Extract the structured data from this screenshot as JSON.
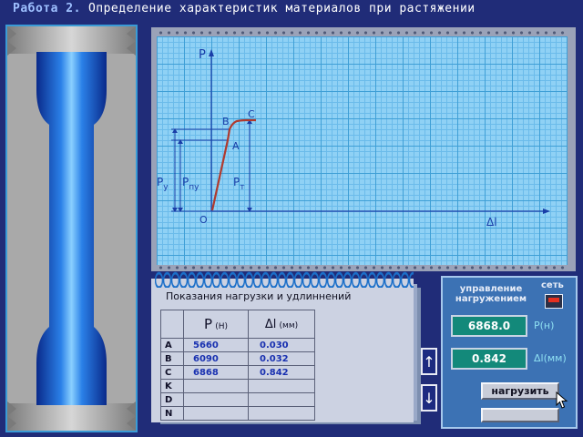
{
  "title": {
    "label": "Работа 2.",
    "text": "Определение характеристик материалов при растяжении"
  },
  "graph": {
    "axis_y": "P",
    "axis_x": "Δl",
    "points": {
      "O": "O",
      "A": "A",
      "B": "B",
      "C": "C"
    },
    "labels": {
      "py": "P",
      "py_sub": "y",
      "ppu": "P",
      "ppu_sub": "пу",
      "pt": "P",
      "pt_sub": "т"
    }
  },
  "table": {
    "title": "Показания нагрузки и удлиннений",
    "col_p": "P",
    "col_p_unit": "(Н)",
    "col_dl": "Δl",
    "col_dl_unit": "(мм)",
    "rows": [
      {
        "label": "A",
        "p": "5660",
        "dl": "0.030"
      },
      {
        "label": "B",
        "p": "6090",
        "dl": "0.032"
      },
      {
        "label": "C",
        "p": "6868",
        "dl": "0.842"
      },
      {
        "label": "K",
        "p": "",
        "dl": ""
      },
      {
        "label": "D",
        "p": "",
        "dl": ""
      },
      {
        "label": "N",
        "p": "",
        "dl": ""
      }
    ]
  },
  "scroll": {
    "up": "↑",
    "down": "↓"
  },
  "control": {
    "heading_line1": "управление",
    "heading_line2": "нагружением",
    "net_label": "сеть",
    "load_value": "6868.0",
    "load_unit": "P(н)",
    "elong_value": "0.842",
    "elong_unit": "Δl(мм)",
    "load_button": "нагрузить",
    "second_button": ""
  },
  "colors": {
    "background": "#202c78",
    "specimen": "#1e6fd6",
    "curve": "#c0392b",
    "lcd": "#13897a",
    "net_indicator": "#e53020"
  }
}
